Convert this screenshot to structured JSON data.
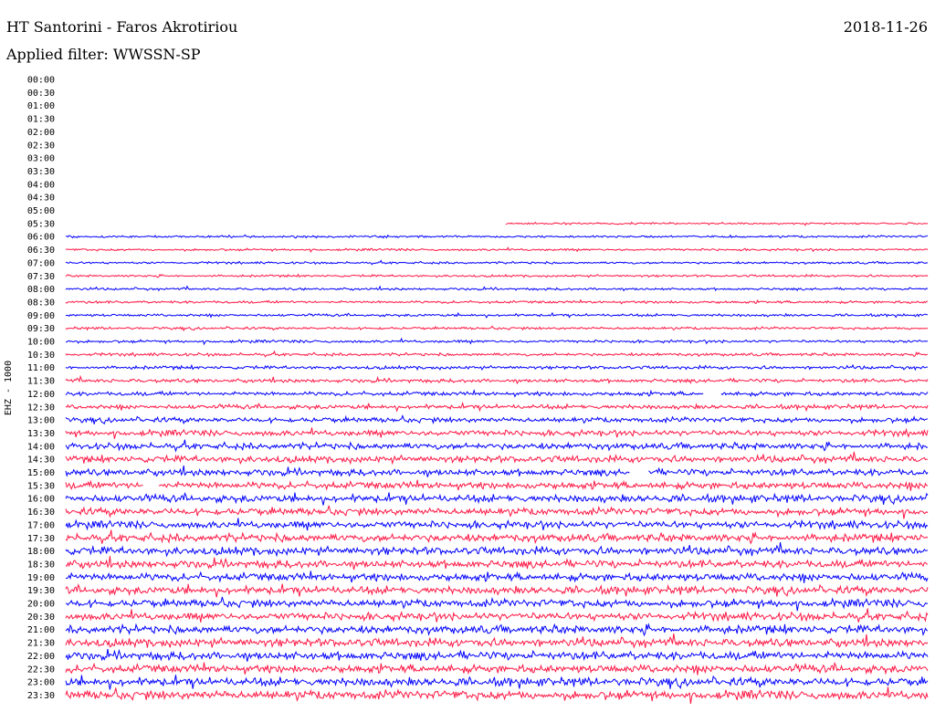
{
  "header": {
    "title": "HT Santorini - Faros Akrotiriou",
    "date": "2018-11-26",
    "filter": "Applied filter: WWSSN-SP"
  },
  "chart_data": {
    "type": "line",
    "title": "HT Santorini - Faros Akrotiriou",
    "ylabel": "EHZ - 1000",
    "xlabel": "",
    "tick_labels": [
      "00:00",
      "00:30",
      "01:00",
      "01:30",
      "02:00",
      "02:30",
      "03:00",
      "03:30",
      "04:00",
      "04:30",
      "05:00",
      "05:30",
      "06:00",
      "06:30",
      "07:00",
      "07:30",
      "08:00",
      "08:30",
      "09:00",
      "09:30",
      "10:00",
      "10:30",
      "11:00",
      "11:30",
      "12:00",
      "12:30",
      "13:00",
      "13:30",
      "14:00",
      "14:30",
      "15:00",
      "15:30",
      "16:00",
      "16:30",
      "17:00",
      "17:30",
      "18:00",
      "18:30",
      "19:00",
      "19:30",
      "20:00",
      "20:30",
      "21:00",
      "21:30",
      "22:00",
      "22:30",
      "23:00",
      "23:30"
    ],
    "series_colors": [
      "#0000ff",
      "#ff1744"
    ],
    "data_start": {
      "row": "05:30",
      "fraction_of_row": 0.51
    },
    "amplitude_by_row": {
      "05:30": 0.25,
      "06:00": 0.3,
      "06:30": 0.3,
      "07:00": 0.3,
      "07:30": 0.3,
      "08:00": 0.32,
      "08:30": 0.35,
      "09:00": 0.35,
      "09:30": 0.35,
      "10:00": 0.38,
      "10:30": 0.4,
      "11:00": 0.45,
      "11:30": 0.5,
      "12:00": 0.55,
      "12:30": 0.6,
      "13:00": 0.7,
      "13:30": 0.8,
      "14:00": 0.85,
      "14:30": 0.9,
      "15:00": 0.9,
      "15:30": 0.95,
      "16:00": 1.0,
      "16:30": 1.0,
      "17:00": 1.0,
      "17:30": 1.05,
      "18:00": 1.05,
      "18:30": 1.05,
      "19:00": 1.05,
      "19:30": 1.05,
      "20:00": 1.05,
      "20:30": 1.05,
      "21:00": 1.1,
      "21:30": 1.1,
      "22:00": 1.1,
      "22:30": 1.1,
      "23:00": 1.15,
      "23:30": 1.2
    },
    "gaps": [
      {
        "row": "12:00",
        "from": 0.74,
        "to": 0.76
      },
      {
        "row": "15:00",
        "from": 0.655,
        "to": 0.675
      },
      {
        "row": "15:30",
        "from": 0.09,
        "to": 0.107
      }
    ],
    "grid": false,
    "legend": "none"
  }
}
